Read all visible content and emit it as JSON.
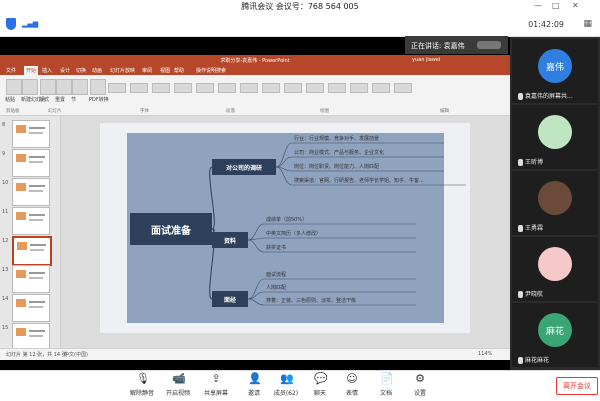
{
  "window": {
    "title": "腾讯会议 会议号：768 564 005"
  },
  "topbar": {
    "time": "01:42:09"
  },
  "speaker": {
    "label": "正在讲话: 袁嘉伟"
  },
  "ppt": {
    "title": "求职分享-袁嘉伟 - PowerPoint",
    "user": "yuan jiawei",
    "tabs": [
      "文件",
      "开始",
      "插入",
      "设计",
      "切换",
      "动画",
      "幻灯片放映",
      "审阅",
      "视图",
      "帮助",
      "操作说明搜索"
    ],
    "active_tab": 1,
    "ribbon": {
      "buttons": [
        "粘贴",
        "新建幻灯片",
        "版式",
        "重置",
        "节",
        "PDF转换"
      ],
      "groups": [
        "剪贴板",
        "幻灯片",
        "字体",
        "段落",
        "绘图",
        "编辑"
      ]
    },
    "thumb_numbers": [
      "8",
      "9",
      "10",
      "11",
      "12",
      "13",
      "14",
      "15"
    ],
    "status": {
      "slide": "幻灯片 第 12 张，共 14 张",
      "lang": "中文(中国)",
      "zoom": "114%"
    }
  },
  "mindmap": {
    "root": "面试准备",
    "branches": [
      {
        "label": "对公司的调研",
        "leaves": [
          "行业：行业规模、竞争对手、发展前景",
          "公司：商业模式、产品与服务、企业文化",
          "岗位：岗位职责、岗位能力、人岗匹配",
          "搜索渠道：官网、行研报告、老师学长学姐、知乎、牛客..."
        ]
      },
      {
        "label": "资料",
        "leaves": [
          "成绩单（前50%）",
          "中英文简历（多人修改）",
          "获奖证书"
        ]
      },
      {
        "label": "面经",
        "leaves": [
          "面试流程",
          "人岗匹配",
          "穿着：正装、三色原则、淡妆、整洁干练"
        ]
      }
    ]
  },
  "participants": [
    {
      "avatar": "嘉伟",
      "name": "袁嘉伟的屏幕共...",
      "color": "#2f7ee0"
    },
    {
      "avatar": "",
      "name": "王昕博",
      "color": "#bfe6c0"
    },
    {
      "avatar": "",
      "name": "王勇霖",
      "color": "#6b4a3a"
    },
    {
      "avatar": "",
      "name": "尹晓航",
      "color": "#f5c9c9"
    },
    {
      "avatar": "麻花",
      "name": "麻花麻花",
      "color": "#3aa676"
    }
  ],
  "toolbar": {
    "items": [
      "解除静音",
      "开启视频",
      "共享屏幕",
      "邀请",
      "成员(62)",
      "聊天",
      "表情",
      "文档",
      "设置"
    ],
    "leave": "离开会议"
  }
}
